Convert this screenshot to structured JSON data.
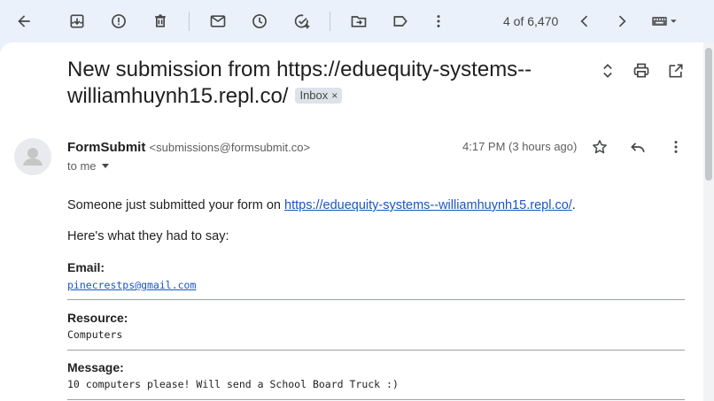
{
  "toolbar": {
    "icons": [
      "back-arrow-icon",
      "archive-icon",
      "report-spam-icon",
      "delete-icon",
      "mark-unread-icon",
      "snooze-icon",
      "add-to-tasks-icon",
      "move-to-icon",
      "label-icon",
      "more-vert-icon",
      "newer-icon",
      "older-icon",
      "keyboard-icon"
    ],
    "counter": "4 of 6,470"
  },
  "email": {
    "subject": "New submission from https://eduequity-systems--williamhuynh15.repl.co/",
    "label": "Inbox",
    "label_close": "×",
    "sender_name": "FormSubmit",
    "sender_email": "<submissions@formsubmit.co>",
    "recipient": "to me",
    "time": "4:17 PM (3 hours ago)",
    "intro_text": "Someone just submitted your form on ",
    "intro_link": "https://eduequity-systems--williamhuynh15.repl.co/",
    "intro_end": ".",
    "says": "Here's what they had to say:",
    "fields": [
      {
        "label": "Email:",
        "value": "pinecrestps@gmail.com"
      },
      {
        "label": "Resource:",
        "value": "Computers"
      },
      {
        "label": "Message:",
        "value": "10 computers please! Will send a School Board Truck :)"
      }
    ]
  },
  "colors": {
    "toolbar_bg": "#eaf1fb",
    "link": "#1a55c4",
    "label_bg": "#dde3ea"
  }
}
